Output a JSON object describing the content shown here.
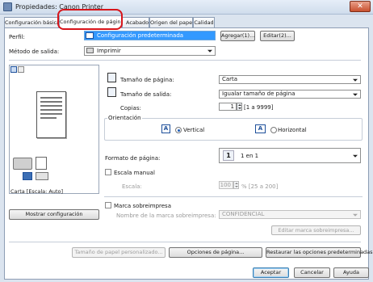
{
  "window": {
    "title": "Propiedades: Canon Printer",
    "close_glyph": "✕"
  },
  "tabs": [
    {
      "label": "Configuración básica"
    },
    {
      "label": "Configuración de página"
    },
    {
      "label": "Acabado"
    },
    {
      "label": "Origen del papel"
    },
    {
      "label": "Calidad"
    }
  ],
  "profile": {
    "label": "Perfil:",
    "value": "Configuración predeterminada",
    "add_button": "Agregar(1)...",
    "edit_button": "Editar(2)..."
  },
  "output": {
    "label": "Método de salida:",
    "value": "Imprimir"
  },
  "preview": {
    "caption": "Carta [Escala: Auto]",
    "show_button": "Mostrar configuración"
  },
  "page_size": {
    "label": "Tamaño de página:",
    "value": "Carta"
  },
  "output_size": {
    "label": "Tamaño de salida:",
    "value": "Igualar tamaño de página"
  },
  "copies": {
    "label": "Copias:",
    "value": "1",
    "range": "[1 a 9999]"
  },
  "orientation": {
    "label": "Orientación",
    "vertical": "Vertical",
    "horizontal": "Horizontal",
    "selected": "Vertical"
  },
  "page_format": {
    "label": "Formato de página:",
    "icon_number": "1",
    "value": "1 en 1"
  },
  "manual_scale": {
    "label": "Escala manual",
    "scale_label": "Escala:",
    "value": "100",
    "range": "% [25 a 200]"
  },
  "watermark": {
    "label": "Marca sobreimpresa",
    "name_label": "Nombre de la marca sobreimpresa:",
    "value": "CONFIDENCIAL",
    "edit_button": "Editar marca sobreimpresa..."
  },
  "bottom_buttons": {
    "custom_paper": "Tamaño de papel personalizado...",
    "page_options": "Opciones de página...",
    "restore": "Restaurar las opciones predeterminadas"
  },
  "dialog_buttons": {
    "ok": "Aceptar",
    "cancel": "Cancelar",
    "help": "Ayuda"
  },
  "colors": {
    "accent": "#3399ff",
    "highlight": "#d7141a"
  }
}
